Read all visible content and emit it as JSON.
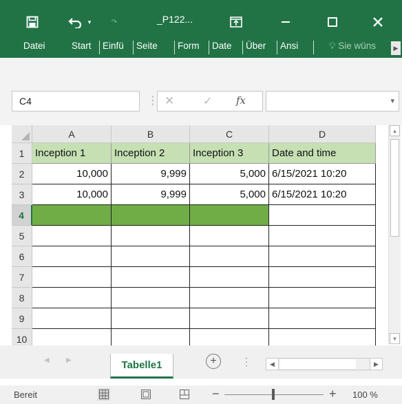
{
  "titlebar": {
    "title": "_P122...",
    "icons": [
      "save-icon",
      "undo-icon",
      "redo-icon",
      "display-options-icon",
      "minimize-icon",
      "maximize-icon",
      "close-icon"
    ]
  },
  "ribbon": {
    "tabs": [
      "Datei",
      "Start",
      "Einfü",
      "Seite",
      "Form",
      "Date",
      "Über",
      "Ansi"
    ],
    "tell_me": "Sie wüns"
  },
  "formula_bar": {
    "name_box": "C4",
    "fx": "fx",
    "content": ""
  },
  "grid": {
    "columns": [
      "A",
      "B",
      "C",
      "D"
    ],
    "rows": [
      [
        "Inception 1",
        "Inception 2",
        "Inception 3",
        "Date and time"
      ],
      [
        "10,000",
        "9,999",
        "5,000",
        "6/15/2021 10:20"
      ],
      [
        "10,000",
        "9,999",
        "5,000",
        "6/15/2021 10:20"
      ],
      [
        "",
        "",
        "",
        ""
      ],
      [
        "",
        "",
        "",
        ""
      ],
      [
        "",
        "",
        "",
        ""
      ],
      [
        "",
        "",
        "",
        ""
      ],
      [
        "",
        "",
        "",
        ""
      ],
      [
        "",
        "",
        "",
        ""
      ],
      [
        "",
        "",
        "",
        ""
      ]
    ],
    "row_numbers": [
      "1",
      "2",
      "3",
      "4",
      "5",
      "6",
      "7",
      "8",
      "9",
      "10"
    ],
    "active_row": "4",
    "header_fill": "#c6e0b4",
    "highlight_fill": "#70ad47"
  },
  "sheets": {
    "tabs": [
      "Tabelle1"
    ],
    "active": "Tabelle1"
  },
  "status": {
    "text": "Bereit",
    "zoom": "100 %"
  },
  "colors": {
    "accent": "#217346"
  }
}
